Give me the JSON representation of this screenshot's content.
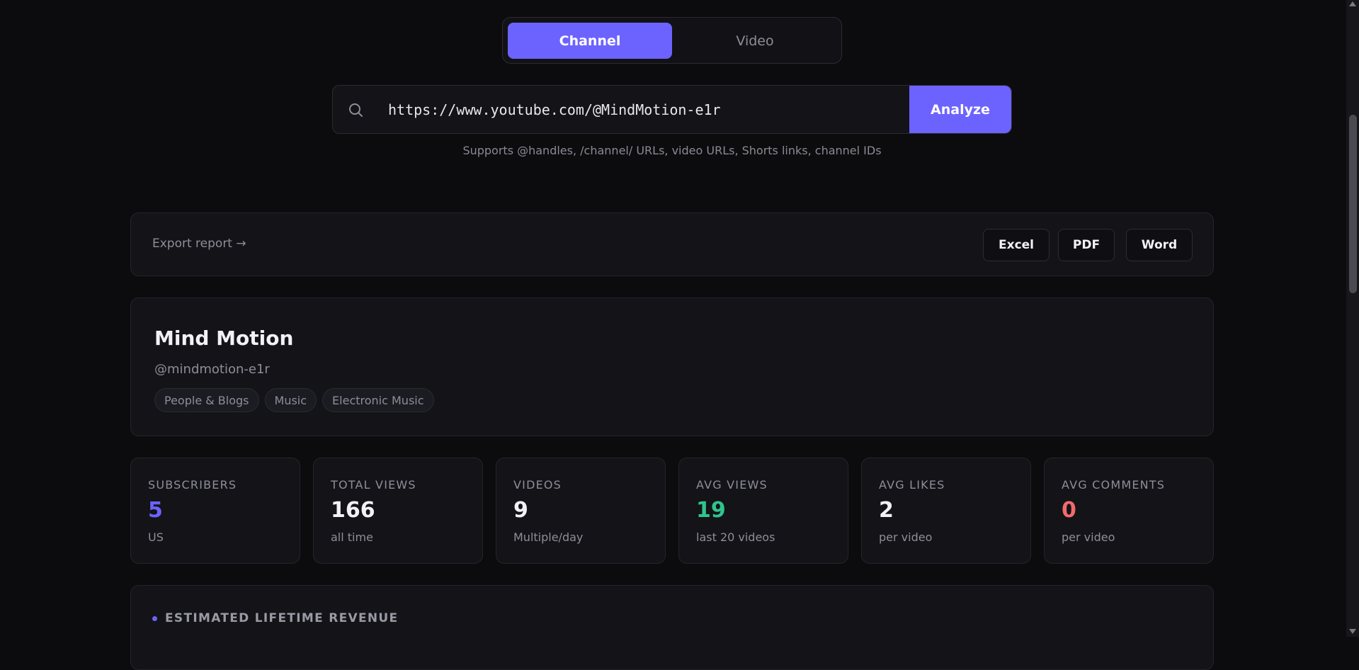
{
  "mode_toggle": {
    "options": [
      "Channel",
      "Video"
    ],
    "selected": "Channel"
  },
  "search": {
    "value": "https://www.youtube.com/@MindMotion-e1r",
    "button_label": "Analyze",
    "hint": "Supports @handles, /channel/ URLs, video URLs, Shorts links, channel IDs"
  },
  "export": {
    "label": "Export report →",
    "buttons": [
      "Excel",
      "PDF",
      "Word"
    ]
  },
  "channel": {
    "name": "Mind Motion",
    "handle": "@mindmotion-e1r",
    "tags": [
      "People & Blogs",
      "Music",
      "Electronic Music"
    ]
  },
  "stats": [
    {
      "label": "SUBSCRIBERS",
      "value": "5",
      "sub": "US",
      "color": "#6c63ff"
    },
    {
      "label": "TOTAL VIEWS",
      "value": "166",
      "sub": "all time",
      "color": "#f2f2f5"
    },
    {
      "label": "VIDEOS",
      "value": "9",
      "sub": "Multiple/day",
      "color": "#f2f2f5"
    },
    {
      "label": "AVG VIEWS",
      "value": "19",
      "sub": "last 20 videos",
      "color": "#2fc48d"
    },
    {
      "label": "AVG LIKES",
      "value": "2",
      "sub": "per video",
      "color": "#f2f2f5"
    },
    {
      "label": "AVG COMMENTS",
      "value": "0",
      "sub": "per video",
      "color": "#f06b6b"
    }
  ],
  "revenue": {
    "title": "ESTIMATED LIFETIME REVENUE"
  },
  "colors": {
    "accent": "#6c63ff",
    "background": "#0c0c0f",
    "card": "#131318"
  }
}
